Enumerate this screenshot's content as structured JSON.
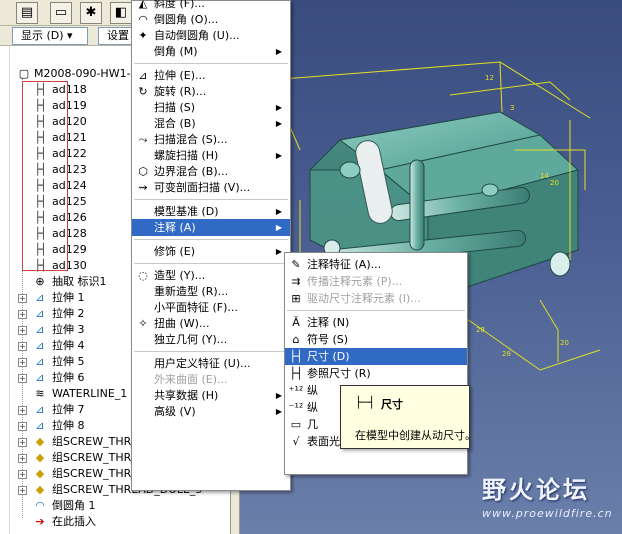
{
  "toolbar": {
    "display_label": "显示 (D) ▾",
    "settings_label": "设置"
  },
  "tree": {
    "root_label": "M2008-090-HW1-ZU",
    "dims": [
      "ad118",
      "ad119",
      "ad120",
      "ad121",
      "ad122",
      "ad123",
      "ad124",
      "ad125",
      "ad126",
      "ad128",
      "ad129",
      "ad130"
    ],
    "items": [
      {
        "label": "抽取 标识1",
        "icon": "extract-icon",
        "expandable": false
      },
      {
        "label": "拉伸 1",
        "icon": "extrude-icon",
        "expandable": true
      },
      {
        "label": "拉伸 2",
        "icon": "extrude-icon",
        "expandable": true
      },
      {
        "label": "拉伸 3",
        "icon": "extrude-icon",
        "expandable": true
      },
      {
        "label": "拉伸 4",
        "icon": "extrude-icon",
        "expandable": true
      },
      {
        "label": "拉伸 5",
        "icon": "extrude-icon",
        "expandable": true
      },
      {
        "label": "拉伸 6",
        "icon": "extrude-icon",
        "expandable": true
      },
      {
        "label": "WATERLINE_1",
        "icon": "waterline-icon",
        "expandable": false
      },
      {
        "label": "拉伸 7",
        "icon": "extrude-icon",
        "expandable": true
      },
      {
        "label": "拉伸 8",
        "icon": "extrude-icon",
        "expandable": true
      },
      {
        "label": "组SCREW_THREA",
        "icon": "screw-group-icon",
        "expandable": true
      },
      {
        "label": "组SCREW_THREA",
        "icon": "screw-group-icon",
        "expandable": true
      },
      {
        "label": "组SCREW_THREA",
        "icon": "screw-group-icon",
        "expandable": true
      },
      {
        "label": "组SCREW_THREAD_DOLE_5",
        "icon": "screw-group-icon",
        "expandable": true
      },
      {
        "label": "倒圆角 1",
        "icon": "round-icon",
        "expandable": false
      },
      {
        "label": "在此插入",
        "icon": "insert-here-icon",
        "expandable": false
      }
    ]
  },
  "context_menu": {
    "items": [
      {
        "label": "斜度 (F)...",
        "icon": "draft-icon",
        "arrow": false,
        "disabled": false
      },
      {
        "label": "倒圆角 (O)...",
        "icon": "round-icon",
        "arrow": false,
        "disabled": false
      },
      {
        "label": "自动倒圆角 (U)...",
        "icon": "auto-round-icon",
        "arrow": false,
        "disabled": false
      },
      {
        "label": "倒角 (M)",
        "icon": "",
        "arrow": true,
        "disabled": false
      },
      {
        "sep": true
      },
      {
        "label": "拉伸 (E)...",
        "icon": "extrude-icon",
        "arrow": false,
        "disabled": false
      },
      {
        "label": "旋转 (R)...",
        "icon": "revolve-icon",
        "arrow": false,
        "disabled": false
      },
      {
        "label": "扫描 (S)",
        "icon": "",
        "arrow": true,
        "disabled": false
      },
      {
        "label": "混合 (B)",
        "icon": "",
        "arrow": true,
        "disabled": false
      },
      {
        "label": "扫描混合 (S)...",
        "icon": "swept-blend-icon",
        "arrow": false,
        "disabled": false
      },
      {
        "label": "螺旋扫描 (H)",
        "icon": "",
        "arrow": true,
        "disabled": false
      },
      {
        "label": "边界混合 (B)...",
        "icon": "boundary-blend-icon",
        "arrow": false,
        "disabled": false
      },
      {
        "label": "可变剖面扫描 (V)...",
        "icon": "var-sweep-icon",
        "arrow": false,
        "disabled": false
      },
      {
        "sep": true
      },
      {
        "label": "模型基准 (D)",
        "icon": "",
        "arrow": true,
        "disabled": false
      },
      {
        "label": "注释 (A)",
        "icon": "",
        "arrow": true,
        "disabled": false,
        "highlight": true
      },
      {
        "sep": true
      },
      {
        "label": "修饰 (E)",
        "icon": "",
        "arrow": true,
        "disabled": false
      },
      {
        "sep": true
      },
      {
        "label": "造型 (Y)...",
        "icon": "style-icon",
        "arrow": false,
        "disabled": false
      },
      {
        "label": "重新造型 (R)...",
        "icon": "",
        "arrow": false,
        "disabled": false
      },
      {
        "label": "小平面特征 (F)...",
        "icon": "",
        "arrow": false,
        "disabled": false
      },
      {
        "label": "扭曲 (W)...",
        "icon": "warp-icon",
        "arrow": false,
        "disabled": false
      },
      {
        "label": "独立几何 (Y)...",
        "icon": "",
        "arrow": false,
        "disabled": false
      },
      {
        "sep": true
      },
      {
        "label": "用户定义特征 (U)...",
        "icon": "",
        "arrow": false,
        "disabled": false
      },
      {
        "label": "外来曲面 (E)...",
        "icon": "",
        "arrow": false,
        "disabled": true
      },
      {
        "label": "共享数据 (H)",
        "icon": "",
        "arrow": true,
        "disabled": false
      },
      {
        "label": "高级 (V)",
        "icon": "",
        "arrow": true,
        "disabled": false
      }
    ]
  },
  "sub_menu": {
    "items": [
      {
        "label": "注释特征 (A)...",
        "icon": "annotation-feature-icon",
        "disabled": false
      },
      {
        "label": "传播注释元素 (P)...",
        "icon": "propagate-icon",
        "disabled": true
      },
      {
        "label": "驱动尺寸注释元素 (I)...",
        "icon": "driving-dim-icon",
        "disabled": true
      },
      {
        "sep": true
      },
      {
        "label": "注释 (N)",
        "icon": "note-icon",
        "disabled": false
      },
      {
        "label": "符号 (S)",
        "icon": "symbol-icon",
        "disabled": false
      },
      {
        "label": "尺寸 (D)",
        "icon": "dimension-icon",
        "disabled": false,
        "highlight": true
      },
      {
        "label": "参照尺寸 (R)",
        "icon": "ref-dim-icon",
        "disabled": false
      },
      {
        "label": "纵",
        "icon": "ordinate-icon",
        "disabled": false
      },
      {
        "label": "纵",
        "icon": "ordinate-ref-icon",
        "disabled": false
      },
      {
        "label": "几",
        "icon": "gtol-icon",
        "disabled": false
      },
      {
        "label": "表面光洁度 (U)",
        "icon": "surface-finish-icon",
        "disabled": false
      }
    ]
  },
  "tooltip": {
    "title": "尺寸",
    "description": "在模型中创建从动尺寸。"
  },
  "watermark": {
    "title": "野火论坛",
    "url": "www.proewildfire.cn"
  },
  "colors": {
    "highlight": "#316ac5",
    "model_body": "#4f9c90",
    "model_edge": "#d8d820"
  }
}
